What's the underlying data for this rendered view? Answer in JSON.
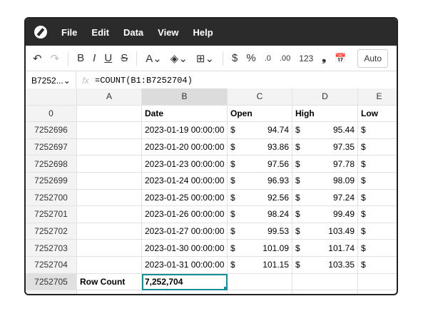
{
  "menu": [
    "File",
    "Edit",
    "Data",
    "View",
    "Help"
  ],
  "toolbar": {
    "undo": "↶",
    "redo": "↷",
    "bold": "B",
    "italic": "I",
    "underline": "U",
    "strike": "S",
    "text_color": "A⌄",
    "fill": "◈⌄",
    "borders": "⊞⌄",
    "currency": "$",
    "percent": "%",
    "dec_decrease": ".0",
    "dec_increase": ".00",
    "number": "123",
    "comma": "❟",
    "date": "📅",
    "format": "Auto"
  },
  "formula_bar": {
    "name_box": "B7252...⌄",
    "fx": "fx",
    "formula": "=COUNT(B1:B7252704)"
  },
  "columns": [
    "A",
    "B",
    "C",
    "D",
    "E"
  ],
  "header_row": {
    "row": "0",
    "a": "",
    "b": "Date",
    "c": "Open",
    "d": "High",
    "e": "Low"
  },
  "rows": [
    {
      "row": "7252696",
      "date": "2023-01-19 00:00:00",
      "open": "94.74",
      "high": "95.44"
    },
    {
      "row": "7252697",
      "date": "2023-01-20 00:00:00",
      "open": "93.86",
      "high": "97.35"
    },
    {
      "row": "7252698",
      "date": "2023-01-23 00:00:00",
      "open": "97.56",
      "high": "97.78"
    },
    {
      "row": "7252699",
      "date": "2023-01-24 00:00:00",
      "open": "96.93",
      "high": "98.09"
    },
    {
      "row": "7252700",
      "date": "2023-01-25 00:00:00",
      "open": "92.56",
      "high": "97.24"
    },
    {
      "row": "7252701",
      "date": "2023-01-26 00:00:00",
      "open": "98.24",
      "high": "99.49"
    },
    {
      "row": "7252702",
      "date": "2023-01-27 00:00:00",
      "open": "99.53",
      "high": "103.49"
    },
    {
      "row": "7252703",
      "date": "2023-01-30 00:00:00",
      "open": "101.09",
      "high": "101.74"
    },
    {
      "row": "7252704",
      "date": "2023-01-31 00:00:00",
      "open": "101.15",
      "high": "103.35"
    }
  ],
  "currency_symbol": "$",
  "count_row": {
    "row": "7252705",
    "label": "Row Count",
    "value": "7,252,704"
  },
  "accent": "#1a8c96"
}
